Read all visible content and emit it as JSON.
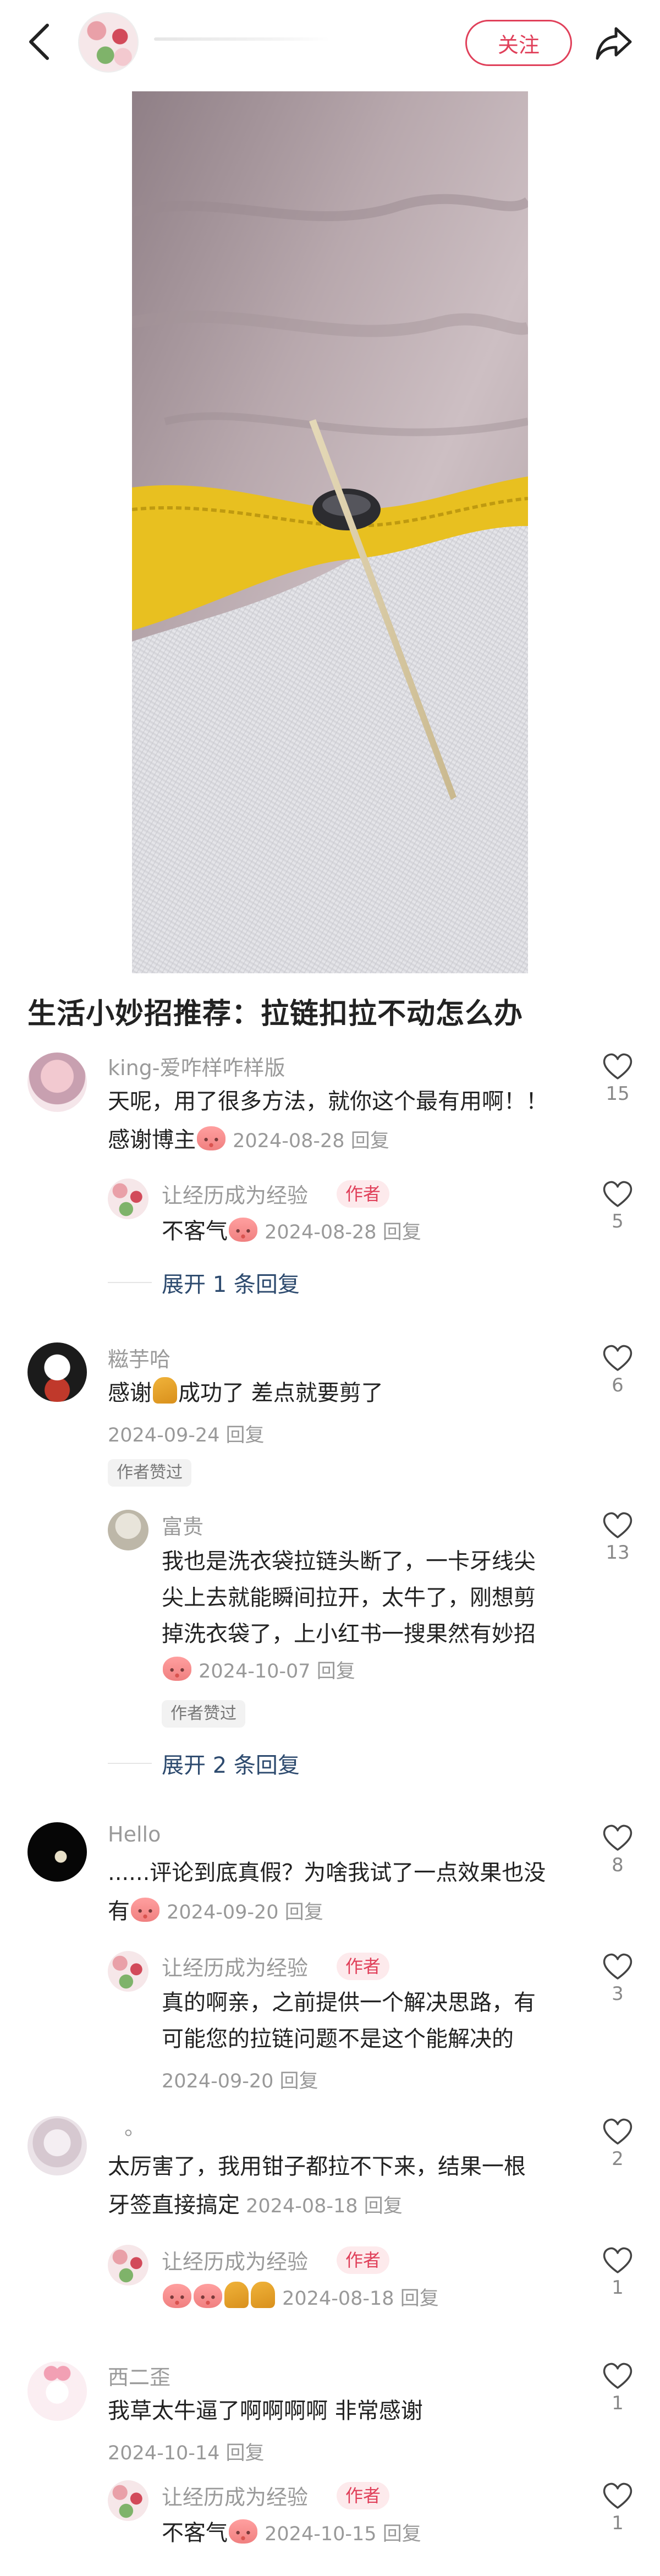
{
  "header": {
    "follow_label": "关注",
    "accent_color": "#e0405a"
  },
  "post": {
    "title": "生活小妙招推荐：拉链扣拉不动怎么办"
  },
  "comments": [
    {
      "user": "king-爱咋样咋样版",
      "lines": [
        "天呢，用了很多方法，就你这个最有用啊！！",
        "感谢博主"
      ],
      "emoji": "smiling-face",
      "date": "2024-08-28",
      "reply_label": "回复",
      "likes": "15",
      "replies": [
        {
          "user": "让经历成为经验",
          "badge": "作者",
          "lines": [
            "不客气"
          ],
          "emoji": "smiling-face",
          "date": "2024-08-28",
          "reply_label": "回复",
          "likes": "5"
        }
      ],
      "expand_label": "展开 1 条回复"
    },
    {
      "user": "糍芋哈",
      "lines": [
        "感谢",
        "成功了 差点就要剪了"
      ],
      "emoji": "folded-hands",
      "date": "2024-09-24",
      "reply_label": "回复",
      "likes": "6",
      "author_liked": "作者赞过",
      "replies": [
        {
          "user": "富贵",
          "lines": [
            "我也是洗衣袋拉链头断了，一卡牙线尖",
            "尖上去就能瞬间拉开，太牛了，刚想剪",
            "掉洗衣袋了，上小红书一搜果然有妙招"
          ],
          "emoji": "smiling-face",
          "date": "2024-10-07",
          "reply_label": "回复",
          "likes": "13",
          "author_liked": "作者赞过"
        }
      ],
      "expand_label": "展开 2 条回复"
    },
    {
      "user": "Hello",
      "lines": [
        "......评论到底真假？为啥我试了一点效果也没",
        "有"
      ],
      "emoji": "smiling-face",
      "date": "2024-09-20",
      "reply_label": "回复",
      "likes": "8",
      "replies": [
        {
          "user": "让经历成为经验",
          "badge": "作者",
          "lines": [
            "真的啊亲，之前提供一个解决思路，有",
            "可能您的拉链问题不是这个能解决的"
          ],
          "date": "2024-09-20",
          "reply_label": "回复",
          "likes": "3"
        }
      ]
    },
    {
      "user": "。",
      "lines": [
        "太厉害了，我用钳子都拉不下来，结果一根",
        "牙签直接搞定"
      ],
      "date": "2024-08-18",
      "reply_label": "回复",
      "likes": "2",
      "replies": [
        {
          "user": "让经历成为经验",
          "badge": "作者",
          "emoji": "smiling-face-folded-hands",
          "date": "2024-08-18",
          "reply_label": "回复",
          "likes": "1"
        }
      ]
    },
    {
      "user": "西二歪",
      "lines": [
        "我草太牛逼了啊啊啊啊 非常感谢"
      ],
      "date": "2024-10-14",
      "reply_label": "回复",
      "likes": "1",
      "replies": [
        {
          "user": "让经历成为经验",
          "badge": "作者",
          "lines": [
            "不客气"
          ],
          "emoji": "smiling-face",
          "date": "2024-10-15",
          "reply_label": "回复",
          "likes": "1"
        }
      ]
    }
  ]
}
